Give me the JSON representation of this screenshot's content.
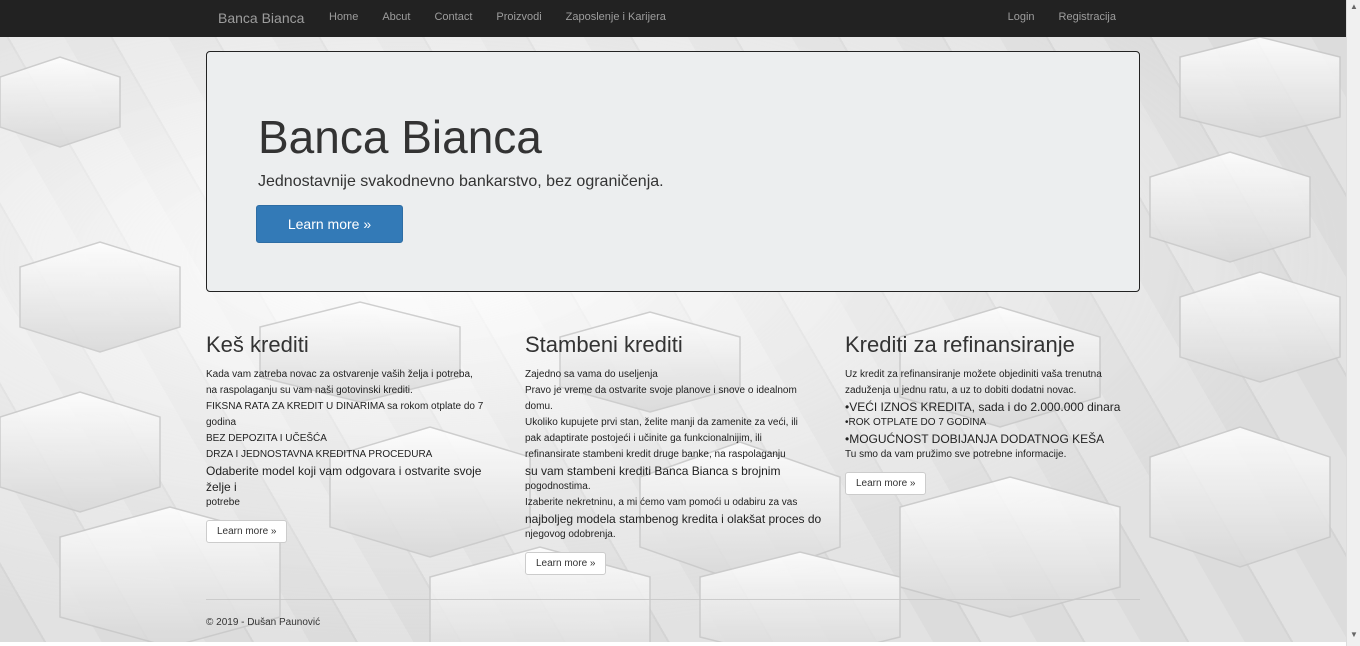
{
  "navbar": {
    "brand": "Banca Bianca",
    "links": [
      "Home",
      "Abcut",
      "Contact",
      "Proizvodi",
      "Zaposlenje i Karijera"
    ],
    "right_links": [
      "Login",
      "Registracija"
    ]
  },
  "jumbotron": {
    "title": "Banca Bianca",
    "subtitle": "Jednostavnije svakodnevno bankarstvo, bez ograničenja.",
    "button": "Learn more »"
  },
  "columns": [
    {
      "title": "Keš krediti",
      "lines": [
        "Kada vam zatreba novac za ostvarenje vaših želja i potreba,",
        "na raspolaganju su vam naši gotovinski krediti.",
        "FIKSNA RATA ZA KREDIT U DINARIMA sa rokom otplate do 7",
        "godina",
        "BEZ DEPOZITA I UČEŠĆA",
        "DRZA I JEDNOSTAVNA KREDITNA PROCEDURA",
        "Odaberite model koji vam odgovara i ostvarite svoje želje i",
        "potrebe"
      ],
      "button": "Learn more »"
    },
    {
      "title": "Stambeni krediti",
      "lines": [
        "Zajedno sa vama do useljenja",
        "Pravo je vreme da ostvarite svoje planove i snove o idealnom",
        "domu.",
        "Ukoliko kupujete prvi stan, želite manji da zamenite za veći, ili",
        "pak adaptirate postojeći i učinite ga funkcionalnijim, ili",
        "refinansirate stambeni kredit druge banke, na raspolaganju",
        "su vam stambeni krediti Banca Bianca s brojnim",
        "pogodnostima.",
        "Izaberite nekretninu, a mi ćemo vam pomoći u odabiru za vas",
        "najboljeg modela stambenog kredita i olakšat proces do",
        "njegovog odobrenja."
      ],
      "button": "Learn more »"
    },
    {
      "title": "Krediti za refinansiranje",
      "lines": [
        "Uz kredit za refinansiranje možete objediniti vaša trenutna",
        "zaduženja u jednu ratu, a uz to dobiti dodatni novac.",
        "•VEĆI IZNOS KREDITA, sada i do 2.000.000 dinara",
        "•ROK OTPLATE DO 7 GODINA",
        "•MOGUĆNOST DOBIJANJA DODATNOG KEŠA",
        "Tu smo da vam pružimo sve potrebne informacije."
      ],
      "button": "Learn more »"
    }
  ],
  "footer": "© 2019 - Dušan Paunović"
}
